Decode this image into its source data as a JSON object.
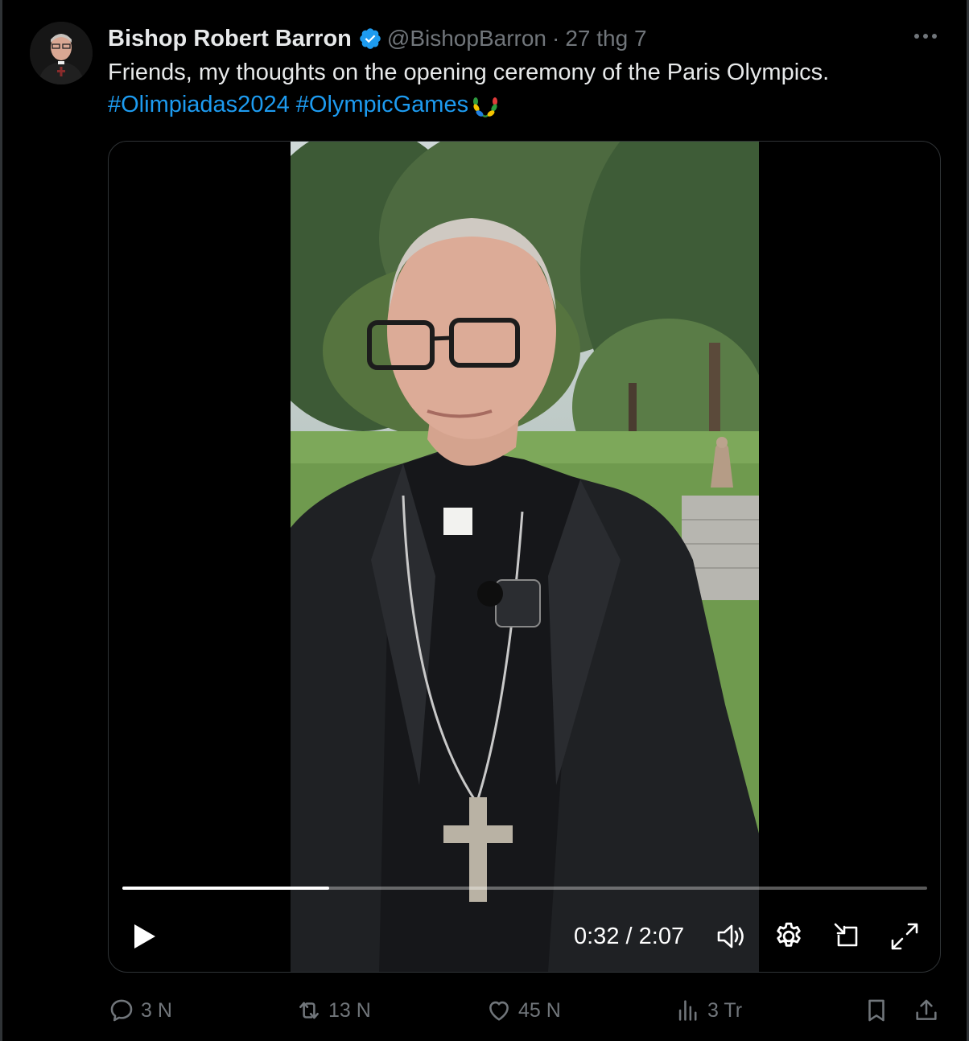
{
  "tweet": {
    "author_name": "Bishop Robert Barron",
    "handle": "@BishopBarron",
    "separator": "·",
    "date": "27 thg 7",
    "text": "Friends, my thoughts on the opening ceremony of the Paris Olympics.",
    "hashtags": [
      "#Olimpiadas2024",
      "#OlympicGames"
    ]
  },
  "video": {
    "current_time": "0:32",
    "time_separator": "/",
    "duration": "2:07",
    "progress_fraction": 0.257
  },
  "actions": {
    "replies": "3 N",
    "reposts": "13 N",
    "likes": "45 N",
    "views": "3 Tr"
  },
  "colors": {
    "background": "#000000",
    "accent": "#1d9bf0",
    "muted": "#71767b",
    "text": "#e7e9ea"
  },
  "icons": [
    "verified-badge-icon",
    "more-icon",
    "play-icon",
    "volume-icon",
    "settings-icon",
    "pip-icon",
    "fullscreen-icon",
    "reply-icon",
    "repost-icon",
    "like-icon",
    "views-icon",
    "bookmark-icon",
    "share-icon"
  ]
}
